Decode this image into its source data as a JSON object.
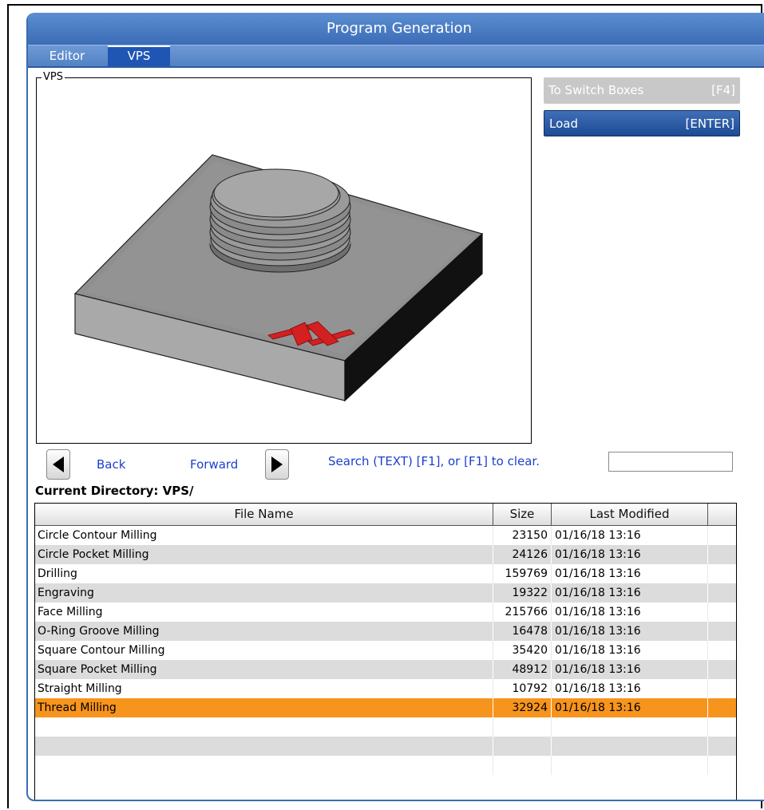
{
  "window": {
    "title": "Program Generation",
    "tabs": [
      {
        "label": "Editor",
        "active": false
      },
      {
        "label": "VPS",
        "active": true
      }
    ]
  },
  "vps_box": {
    "legend": "VPS"
  },
  "side_buttons": {
    "switch_boxes": {
      "label": "To Switch Boxes",
      "key": "[F4]"
    },
    "load": {
      "label": "Load",
      "key": "[ENTER]"
    }
  },
  "navigation": {
    "back_label": "Back",
    "forward_label": "Forward",
    "search_hint": "Search (TEXT) [F1], or [F1] to clear.",
    "search_value": ""
  },
  "current_directory": "Current Directory: VPS/",
  "file_table": {
    "columns": [
      "File Name",
      "Size",
      "Last Modified",
      ""
    ],
    "rows": [
      {
        "name": "Circle Contour Milling",
        "size": "23150",
        "modified": "01/16/18 13:16"
      },
      {
        "name": "Circle Pocket Milling",
        "size": "24126",
        "modified": "01/16/18 13:16"
      },
      {
        "name": "Drilling",
        "size": "159769",
        "modified": "01/16/18 13:16"
      },
      {
        "name": "Engraving",
        "size": "19322",
        "modified": "01/16/18 13:16"
      },
      {
        "name": "Face Milling",
        "size": "215766",
        "modified": "01/16/18 13:16"
      },
      {
        "name": "O-Ring Groove Milling",
        "size": "16478",
        "modified": "01/16/18 13:16"
      },
      {
        "name": "Square Contour Milling",
        "size": "35420",
        "modified": "01/16/18 13:16"
      },
      {
        "name": "Square Pocket Milling",
        "size": "48912",
        "modified": "01/16/18 13:16"
      },
      {
        "name": "Straight Milling",
        "size": "10792",
        "modified": "01/16/18 13:16"
      },
      {
        "name": "Thread Milling",
        "size": "32924",
        "modified": "01/16/18 13:16",
        "selected": true
      },
      {
        "name": "",
        "size": "",
        "modified": ""
      },
      {
        "name": "",
        "size": "",
        "modified": ""
      },
      {
        "name": "",
        "size": "",
        "modified": ""
      }
    ]
  },
  "colors": {
    "selection": "#f7941d",
    "link": "#1b3fcf",
    "title_bar": "#4a7cc4",
    "logo_red": "#d42020"
  }
}
